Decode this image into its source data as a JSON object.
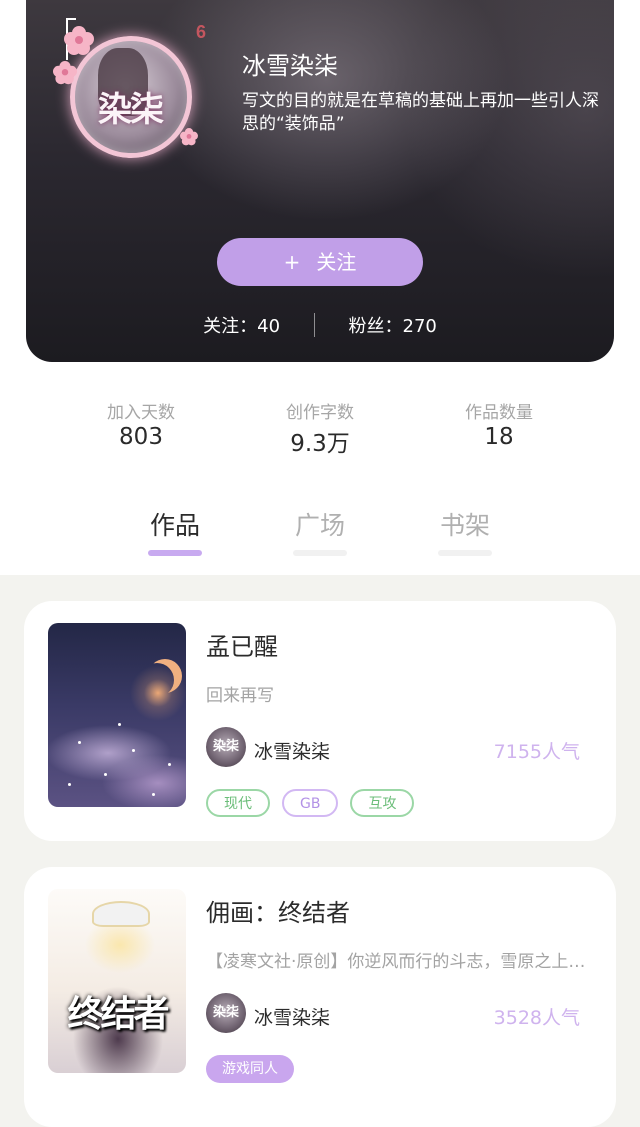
{
  "profile": {
    "name": "冰雪染柒",
    "bio": "写文的目的就是在草稿的基础上再加一些引人深思的“装饰品”",
    "avatar_text": "染柒",
    "level": "6",
    "follow_button": "关注",
    "follow_button_icon": "+",
    "following_label": "关注：",
    "following_count": "40",
    "fans_label": "粉丝：",
    "fans_count": "270"
  },
  "stats": [
    {
      "label": "加入天数",
      "value": "803"
    },
    {
      "label": "创作字数",
      "value": "9.3万"
    },
    {
      "label": "作品数量",
      "value": "18"
    }
  ],
  "tabs": [
    {
      "label": "作品",
      "active": true
    },
    {
      "label": "广场",
      "active": false
    },
    {
      "label": "书架",
      "active": false
    }
  ],
  "works": [
    {
      "title": "孟已醒",
      "description": "回来再写",
      "author": "冰雪染柒",
      "author_avatar_text": "染柒",
      "popularity": "7155人气",
      "tags": [
        {
          "label": "现代",
          "style": "green"
        },
        {
          "label": "GB",
          "style": "purple"
        },
        {
          "label": "互攻",
          "style": "green"
        }
      ]
    },
    {
      "title": "佣画：终结者",
      "description": "【凌寒文社·原创】你逆风而行的斗志，雪原之上的风...",
      "cover_text": "终结者",
      "author": "冰雪染柒",
      "author_avatar_text": "染柒",
      "popularity": "3528人气",
      "tags": [
        {
          "label": "游戏同人",
          "style": "filled"
        }
      ]
    }
  ],
  "colors": {
    "accent": "#c19fe8",
    "popularity": "#cfb3ee",
    "tag_green": "#6bbd79",
    "tag_purple": "#b392e6",
    "background": "#f3f3ef"
  }
}
